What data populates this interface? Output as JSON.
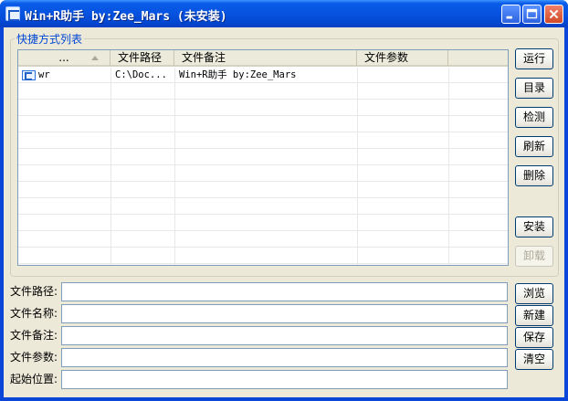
{
  "window": {
    "title": "Win+R助手 by:Zee_Mars (未安装)"
  },
  "group": {
    "label": "快捷方式列表"
  },
  "list": {
    "columns": [
      "...",
      "文件路径",
      "文件备注",
      "文件参数"
    ],
    "rows": [
      {
        "name": "wr",
        "path": "C:\\Doc...",
        "note": "Win+R助手 by:Zee_Mars",
        "params": ""
      }
    ]
  },
  "side_buttons": {
    "run": "运行",
    "directory": "目录",
    "detect": "检测",
    "refresh": "刷新",
    "delete": "删除",
    "install": "安装",
    "uninstall": "卸载"
  },
  "fields": [
    {
      "label": "文件路径:",
      "value": ""
    },
    {
      "label": "文件名称:",
      "value": ""
    },
    {
      "label": "文件备注:",
      "value": ""
    },
    {
      "label": "文件参数:",
      "value": ""
    },
    {
      "label": "起始位置:",
      "value": ""
    }
  ],
  "field_buttons": {
    "browse": "浏览",
    "new": "新建",
    "save": "保存",
    "clear": "清空"
  },
  "colors": {
    "titlebar": "#0653e0",
    "group_label": "#0046d5",
    "client_bg": "#ece9d8"
  },
  "icons": {
    "app": "app-icon",
    "row": "shortcut-icon",
    "minimize": "minimize-icon",
    "maximize": "maximize-icon",
    "close": "close-icon"
  }
}
